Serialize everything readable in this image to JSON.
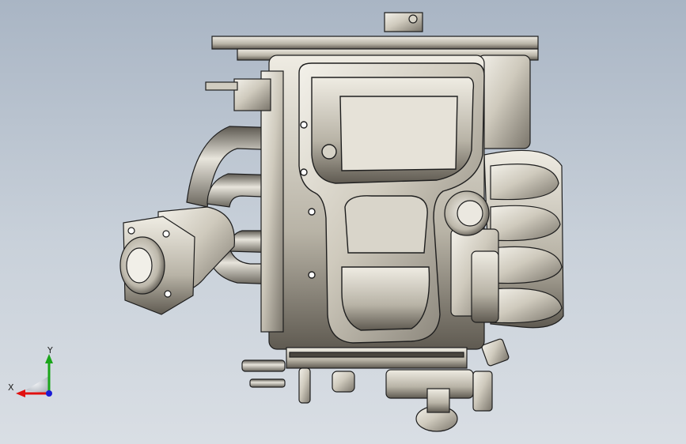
{
  "window": {
    "background_top": "#a9b5c4",
    "background_bottom": "#d9dee4"
  },
  "model": {
    "material_light": "#e9e6dc",
    "material_dark": "#6f6a60",
    "edge_color": "#1e1e1e"
  },
  "triad": {
    "x_label": "X",
    "y_label": "Y",
    "x_color": "#e01010",
    "y_color": "#1aa51a",
    "z_color": "#1b1bd6"
  }
}
